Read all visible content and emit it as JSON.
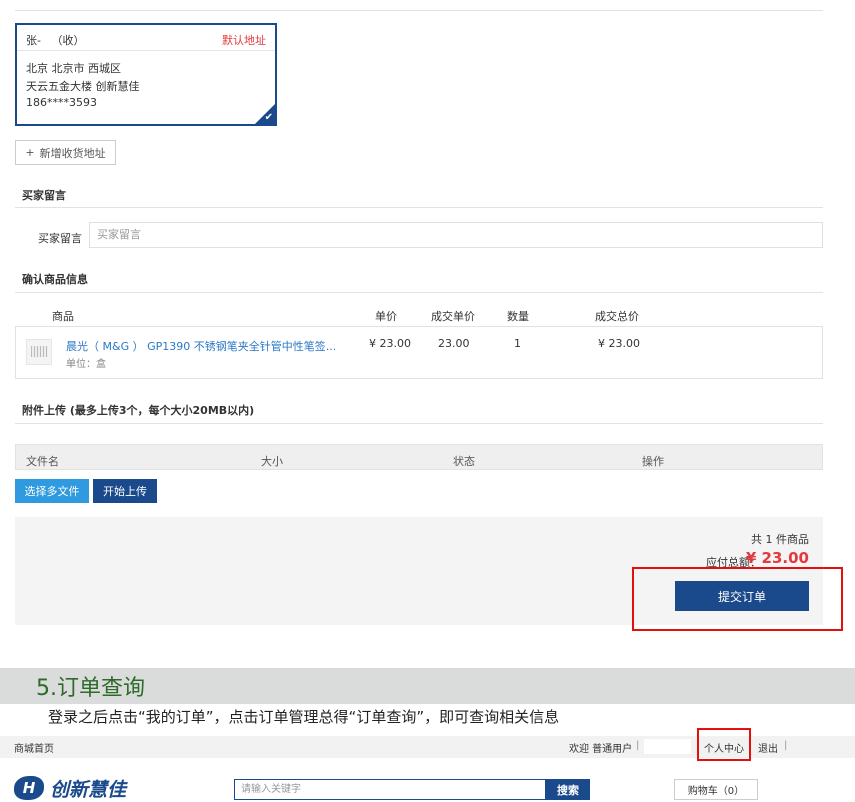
{
  "address": {
    "name": "张-",
    "receive_tag": "（收）",
    "default_label": "默认地址",
    "region": "北京 北京市 西城区",
    "street": "天云五金大楼 创新慧佳",
    "phone": "186****3593",
    "add_button": "新增收货地址"
  },
  "buyer_note": {
    "section_title": "买家留言",
    "label": "买家留言",
    "placeholder": "买家留言"
  },
  "goods": {
    "section_title": "确认商品信息",
    "headers": {
      "product": "商品",
      "price": "单价",
      "deal_price": "成交单价",
      "qty": "数量",
      "total": "成交总价"
    },
    "row": {
      "name": "晨光（ M&G ） GP1390 不锈钢笔夹全针管中性笔签...",
      "unit": "单位：盒",
      "price": "¥ 23.00",
      "deal_price": "23.00",
      "qty": "1",
      "total": "¥ 23.00"
    }
  },
  "attachments": {
    "section_title": "附件上传 (最多上传3个，每个大小20MB以内)",
    "headers": {
      "filename": "文件名",
      "size": "大小",
      "status": "状态",
      "action": "操作"
    },
    "select_button": "选择多文件",
    "start_button": "开始上传"
  },
  "summary": {
    "count_text": "共 1 件商品",
    "total_label": "应付总额：",
    "total_value": "¥ 23.00",
    "submit_button": "提交订单"
  },
  "tutorial": {
    "title": "5.订单查询",
    "description": "登录之后点击“我的订单”，点击订单管理总得“订单查询”，即可查询相关信息"
  },
  "topbar": {
    "home": "商城首页",
    "welcome": "欢迎 普通用户",
    "separator": "|",
    "user_center": "个人中心",
    "logout": "退出"
  },
  "header": {
    "logo_text": "创新慧佳",
    "search_placeholder": "请输入关键字",
    "search_button": "搜索",
    "cart": "购物车（0）"
  },
  "colors": {
    "primary": "#1b4a8c",
    "accent_red": "#e4393c",
    "highlight": "#e50f0f",
    "link": "#2a78c6"
  }
}
